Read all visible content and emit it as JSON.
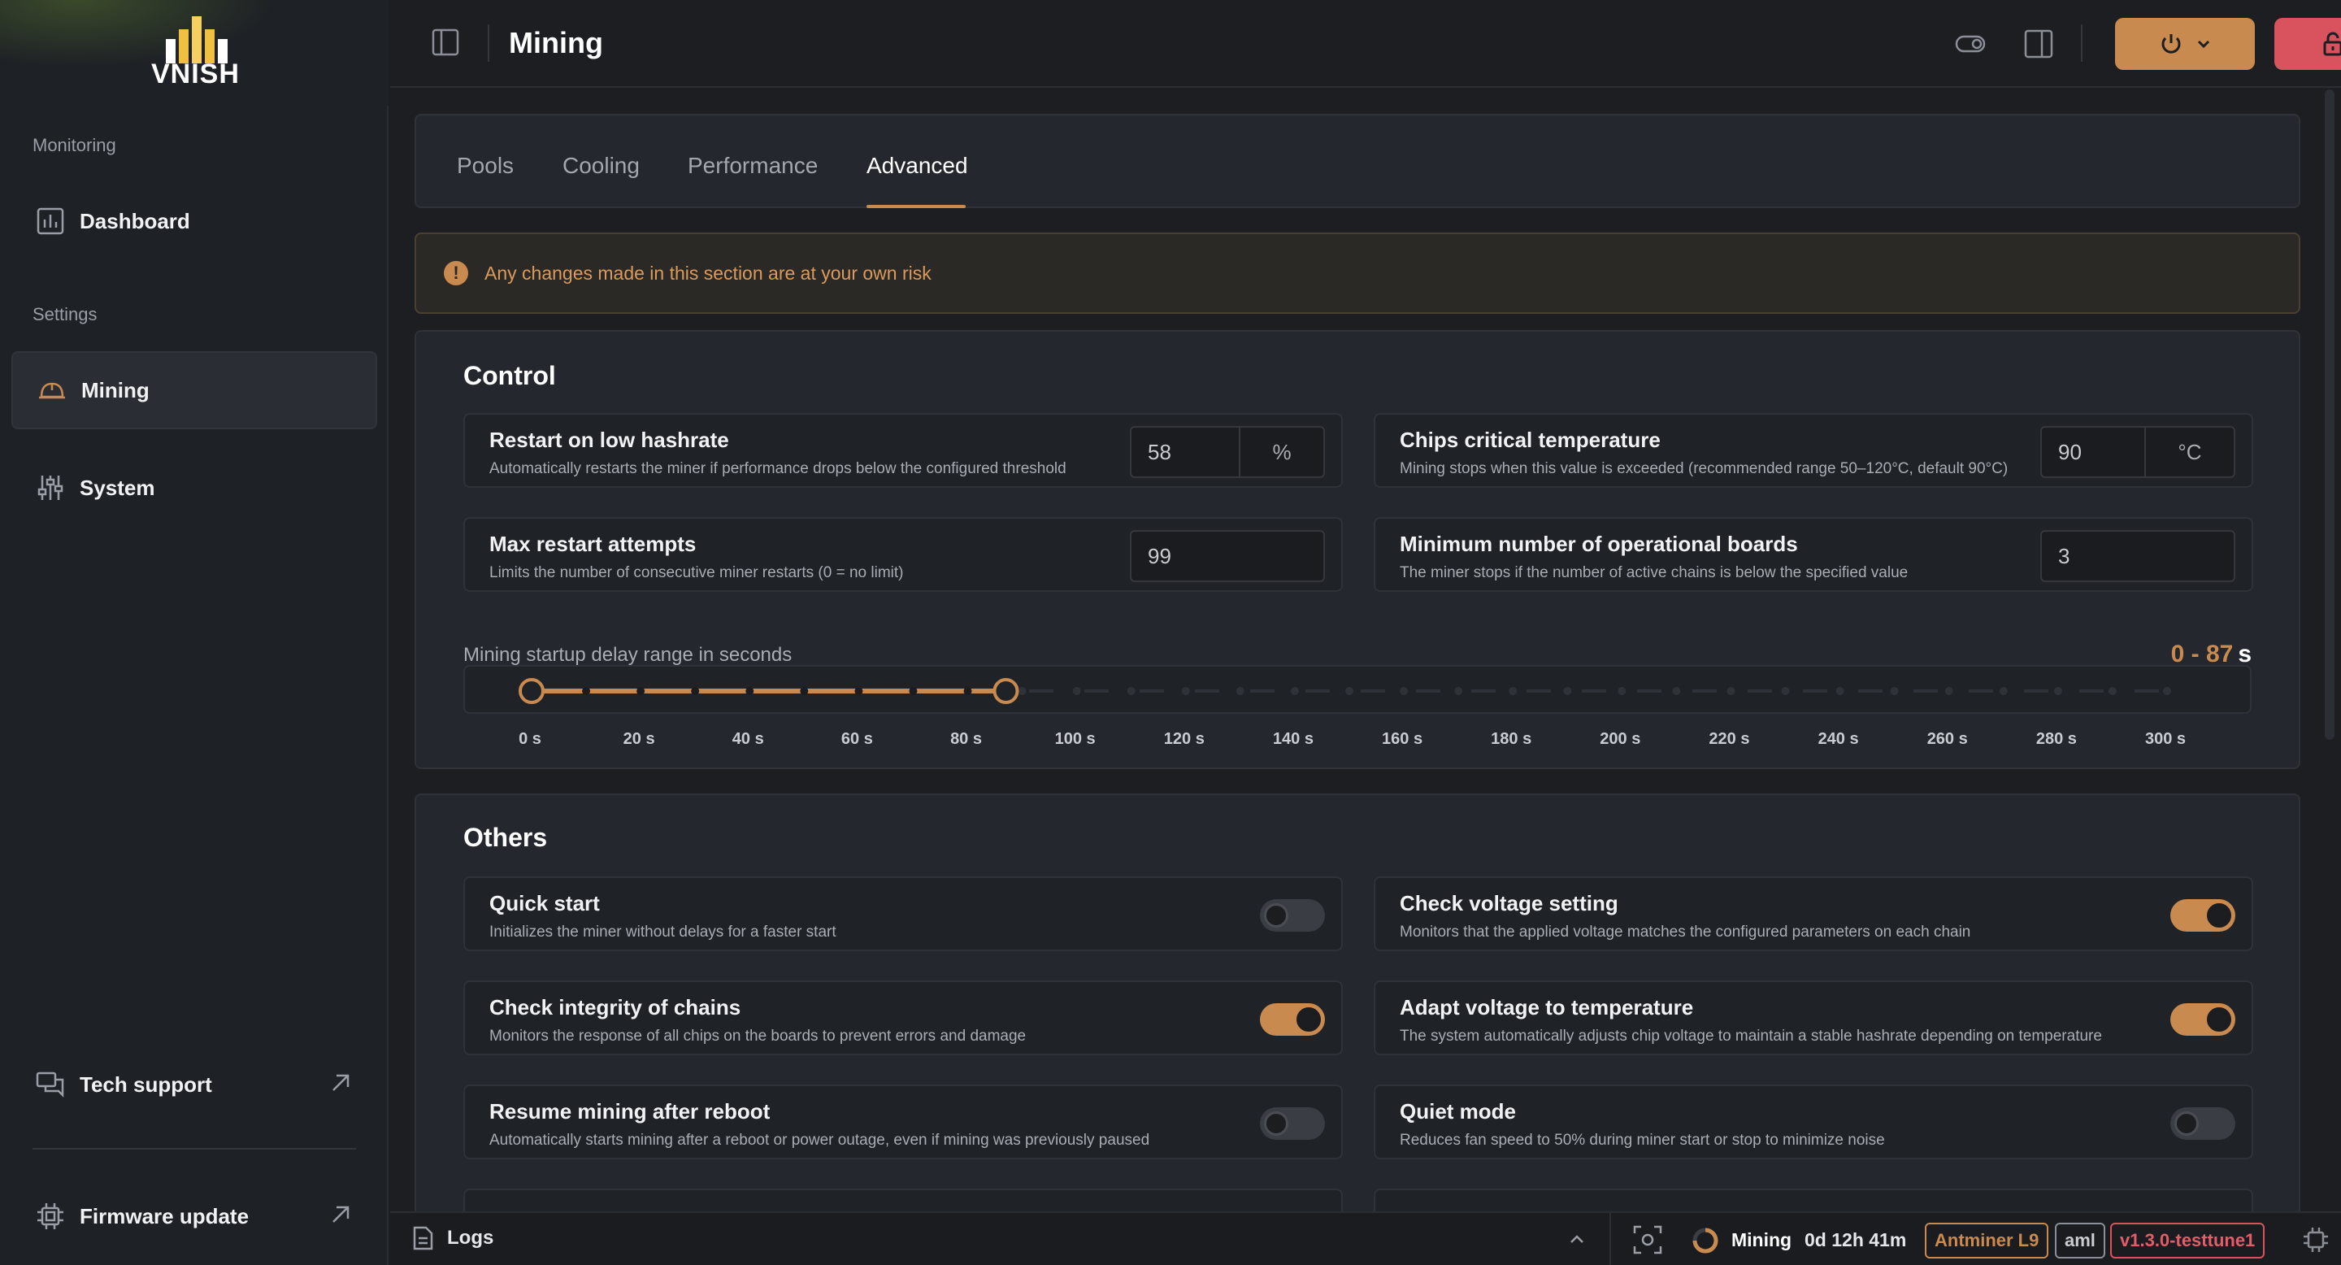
{
  "brand": {
    "name": "VNISH"
  },
  "sidebar": {
    "sections": {
      "monitoring": "Monitoring",
      "settings": "Settings"
    },
    "items": [
      {
        "label": "Dashboard",
        "icon": "bar-chart-icon"
      },
      {
        "label": "Mining",
        "icon": "miner-helmet-icon",
        "active": true
      },
      {
        "label": "System",
        "icon": "sliders-icon"
      },
      {
        "label": "Tech support",
        "icon": "chat-icon",
        "external": true
      },
      {
        "label": "Firmware update",
        "icon": "chip-icon",
        "external": true
      }
    ]
  },
  "header": {
    "title": "Mining"
  },
  "tabs": [
    {
      "label": "Pools"
    },
    {
      "label": "Cooling"
    },
    {
      "label": "Performance"
    },
    {
      "label": "Advanced",
      "active": true
    }
  ],
  "warning": {
    "text": "Any changes made in this section are at your own risk"
  },
  "control": {
    "title": "Control",
    "restart_low_hashrate": {
      "name": "Restart on low hashrate",
      "desc": "Automatically restarts the miner if performance drops below the configured threshold",
      "value": "58",
      "unit": "%"
    },
    "chips_critical_temp": {
      "name": "Chips critical temperature",
      "desc": "Mining stops when this value is exceeded (recommended range 50–120°C, default 90°C)",
      "value": "90",
      "unit": "°C"
    },
    "max_restart": {
      "name": "Max restart attempts",
      "desc": "Limits the number of consecutive miner restarts (0 = no limit)",
      "value": "99"
    },
    "min_boards": {
      "name": "Minimum number of operational boards",
      "desc": "The miner stops if the number of active chains is below the specified value",
      "value": "3"
    },
    "startup_delay": {
      "label": "Mining startup delay range in seconds",
      "range_text": "0 - 87",
      "unit": "s",
      "min": 0,
      "max": 300,
      "low": 0,
      "high": 87,
      "step": 10,
      "ticks": [
        "0 s",
        "20 s",
        "40 s",
        "60 s",
        "80 s",
        "100 s",
        "120 s",
        "140 s",
        "160 s",
        "180 s",
        "200 s",
        "220 s",
        "240 s",
        "260 s",
        "280 s",
        "300 s"
      ]
    }
  },
  "others": {
    "title": "Others",
    "items": [
      {
        "name": "Quick start",
        "desc": "Initializes the miner without delays for a faster start",
        "on": false
      },
      {
        "name": "Check voltage setting",
        "desc": "Monitors that the applied voltage matches the configured parameters on each chain",
        "on": true
      },
      {
        "name": "Check integrity of chains",
        "desc": "Monitors the response of all chips on the boards to prevent errors and damage",
        "on": true
      },
      {
        "name": "Adapt voltage to temperature",
        "desc": "The system automatically adjusts chip voltage to maintain a stable hashrate depending on temperature",
        "on": true
      },
      {
        "name": "Resume mining after reboot",
        "desc": "Automatically starts mining after a reboot or power outage, even if mining was previously paused",
        "on": false
      },
      {
        "name": "Quiet mode",
        "desc": "Reduces fan speed to 50% during miner start or stop to minimize noise",
        "on": false
      }
    ]
  },
  "statusbar": {
    "logs": "Logs",
    "status": "Mining",
    "uptime": "0d 12h 41m",
    "model": "Antminer L9",
    "platform": "aml",
    "version": "v1.3.0-testtune1"
  },
  "colors": {
    "accent": "#c98a50",
    "danger": "#d9535f",
    "bg": "#1c1e22",
    "card": "#24272d"
  }
}
